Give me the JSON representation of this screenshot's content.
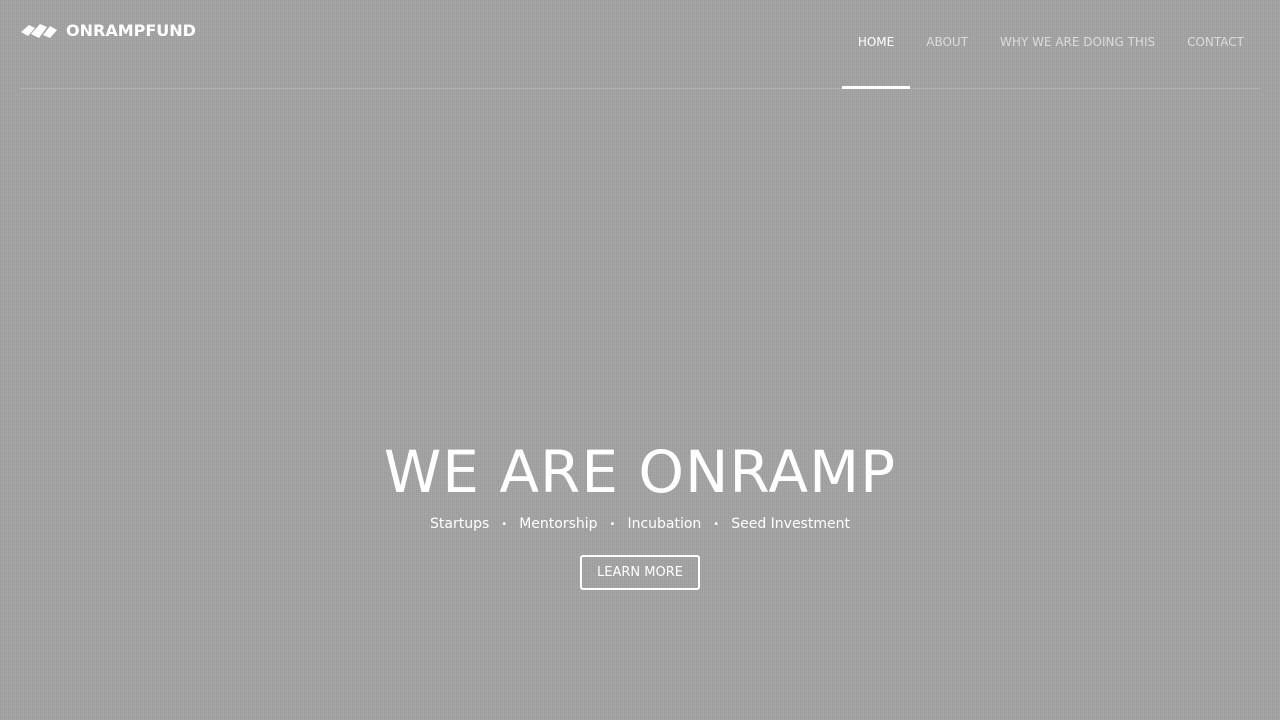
{
  "brand": {
    "name": "ONRAMPFUND",
    "logo_icon": "onramp-logo-icon"
  },
  "nav": {
    "items": [
      {
        "label": "HOME",
        "active": true
      },
      {
        "label": "ABOUT",
        "active": false
      },
      {
        "label": "WHY WE ARE DOING THIS",
        "active": false
      },
      {
        "label": "CONTACT",
        "active": false
      }
    ]
  },
  "hero": {
    "title": "WE ARE ONRAMP",
    "tags": [
      "Startups",
      "Mentorship",
      "Incubation",
      "Seed Investment"
    ],
    "separator": "•",
    "cta_label": "LEARN MORE"
  },
  "colors": {
    "background": "#a3a3a3",
    "text": "#ffffff",
    "nav_inactive": "rgba(255,255,255,0.62)"
  }
}
